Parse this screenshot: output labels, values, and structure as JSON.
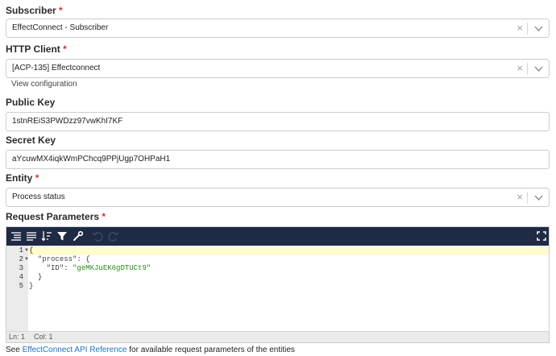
{
  "subscriber": {
    "label": "Subscriber",
    "required": "*",
    "value": "EffectConnect - Subscriber",
    "clear_glyph": "×"
  },
  "http_client": {
    "label": "HTTP Client",
    "required": "*",
    "value": "[ACP-135] Effectconnect",
    "clear_glyph": "×",
    "view_config": "View configuration"
  },
  "public_key": {
    "label": "Public Key",
    "value": "1stnREiS3PWDzz97vwKhI7KF"
  },
  "secret_key": {
    "label": "Secret Key",
    "value": "aYcuwMX4iqkWmPChcq9PPjUgp7OHPaH1"
  },
  "entity": {
    "label": "Entity",
    "required": "*",
    "value": "Process status",
    "clear_glyph": "×"
  },
  "request_parameters": {
    "label": "Request Parameters",
    "required": "*",
    "toolbar_icons": [
      "format-icon",
      "compact-icon",
      "sort-icon",
      "filter-icon",
      "repair-icon",
      "undo-icon",
      "redo-icon",
      "fullscreen-icon"
    ],
    "line_numbers": [
      "1",
      "2",
      "3",
      "4",
      "5"
    ],
    "code": {
      "line1": "{",
      "line2_key": "\"process\"",
      "line2_rest": ": {",
      "line3_key": "\"ID\"",
      "line3_colon": ": ",
      "line3_value": "\"geMKJuEK6gDTUCt9\"",
      "line4": "}",
      "line5": "}"
    },
    "status_ln": "Ln: 1",
    "status_col": "Col: 1"
  },
  "footer": {
    "prefix": "See ",
    "link": "EffectConnect API Reference",
    "suffix": " for available request parameters of the entities"
  },
  "colors": {
    "toolbar_bg": "#1f2a44",
    "required": "#d9302c",
    "link": "#1a73c8",
    "json_string": "#2a8a1a"
  }
}
